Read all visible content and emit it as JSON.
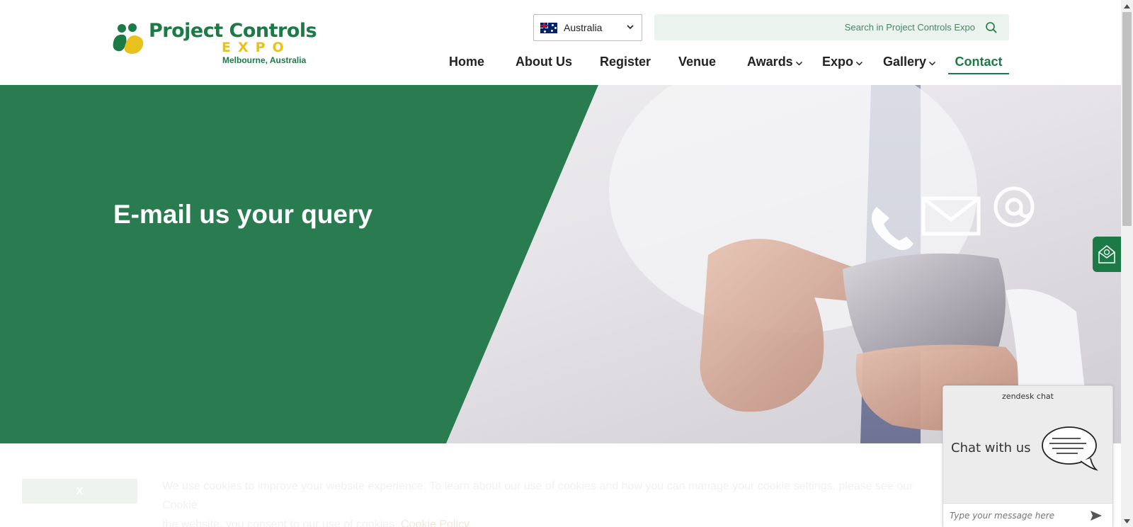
{
  "logo": {
    "title": "Project Controls",
    "subtitle": "EXPO",
    "location": "Melbourne, Australia"
  },
  "country_select": {
    "value": "Australia"
  },
  "search": {
    "placeholder": "Search in Project Controls Expo"
  },
  "nav": [
    {
      "label": "Home"
    },
    {
      "label": "About Us"
    },
    {
      "label": "Register"
    },
    {
      "label": "Venue"
    },
    {
      "label": "Awards"
    },
    {
      "label": "Expo"
    },
    {
      "label": "Gallery"
    },
    {
      "label": "Contact"
    }
  ],
  "hero": {
    "title": "E-mail us your query"
  },
  "cookie": {
    "close_label": "X",
    "text": "We use cookies to improve your website experience. To learn about our use of cookies and how you can manage your cookie settings, please see our Cookie",
    "text2": "the website, you consent to our use of cookies.",
    "link": "Cookie Policy"
  },
  "chat": {
    "brand": "zendesk chat",
    "label": "Chat with us",
    "input_placeholder": "Type your message here"
  },
  "colors": {
    "brand_green": "#1b7a45",
    "brand_yellow": "#e8c11c"
  }
}
